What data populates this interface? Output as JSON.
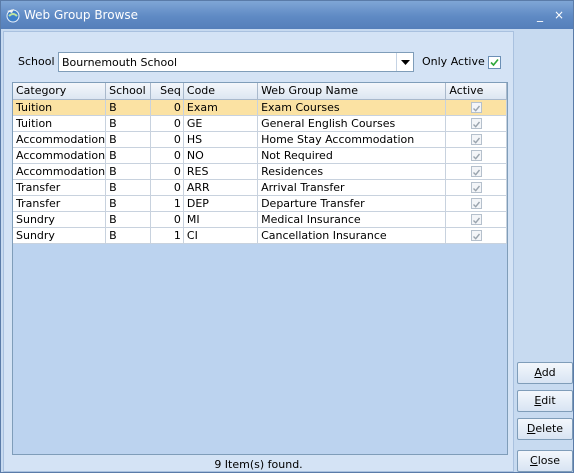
{
  "window": {
    "title": "Web Group Browse"
  },
  "filters": {
    "school_label": "School",
    "school_value": "Bournemouth School",
    "only_active_label": "Only Active",
    "only_active_checked": true
  },
  "grid": {
    "columns": [
      "Category",
      "School",
      "Seq",
      "Code",
      "Web Group Name",
      "Active"
    ],
    "rows": [
      {
        "category": "Tuition",
        "school": "B",
        "seq": "0",
        "code": "Exam",
        "name": "Exam Courses",
        "active": true
      },
      {
        "category": "Tuition",
        "school": "B",
        "seq": "0",
        "code": "GE",
        "name": "General English Courses",
        "active": true
      },
      {
        "category": "Accommodation",
        "school": "B",
        "seq": "0",
        "code": "HS",
        "name": "Home Stay Accommodation",
        "active": true
      },
      {
        "category": "Accommodation",
        "school": "B",
        "seq": "0",
        "code": "NO",
        "name": "Not Required",
        "active": true
      },
      {
        "category": "Accommodation",
        "school": "B",
        "seq": "0",
        "code": "RES",
        "name": "Residences",
        "active": true
      },
      {
        "category": "Transfer",
        "school": "B",
        "seq": "0",
        "code": "ARR",
        "name": "Arrival Transfer",
        "active": true
      },
      {
        "category": "Transfer",
        "school": "B",
        "seq": "1",
        "code": "DEP",
        "name": "Departure Transfer",
        "active": true
      },
      {
        "category": "Sundry",
        "school": "B",
        "seq": "0",
        "code": "MI",
        "name": "Medical Insurance",
        "active": true
      },
      {
        "category": "Sundry",
        "school": "B",
        "seq": "1",
        "code": "CI",
        "name": "Cancellation Insurance",
        "active": true
      }
    ],
    "selected_row": 0,
    "selected_color": "#fbe2a3"
  },
  "status": "9 Item(s) found.",
  "buttons": {
    "add_mnemonic": "A",
    "add_rest": "dd",
    "edit_mnemonic": "E",
    "edit_rest": "dit",
    "delete_mnemonic": "D",
    "delete_rest": "elete",
    "close_mnemonic": "C",
    "close_rest": "lose"
  },
  "titlebar_buttons": {
    "minimize": "_",
    "close": "×"
  },
  "icons": {
    "app": "globe-arrow-icon",
    "dropdown": "chevron-down-icon",
    "check": "check-icon"
  }
}
